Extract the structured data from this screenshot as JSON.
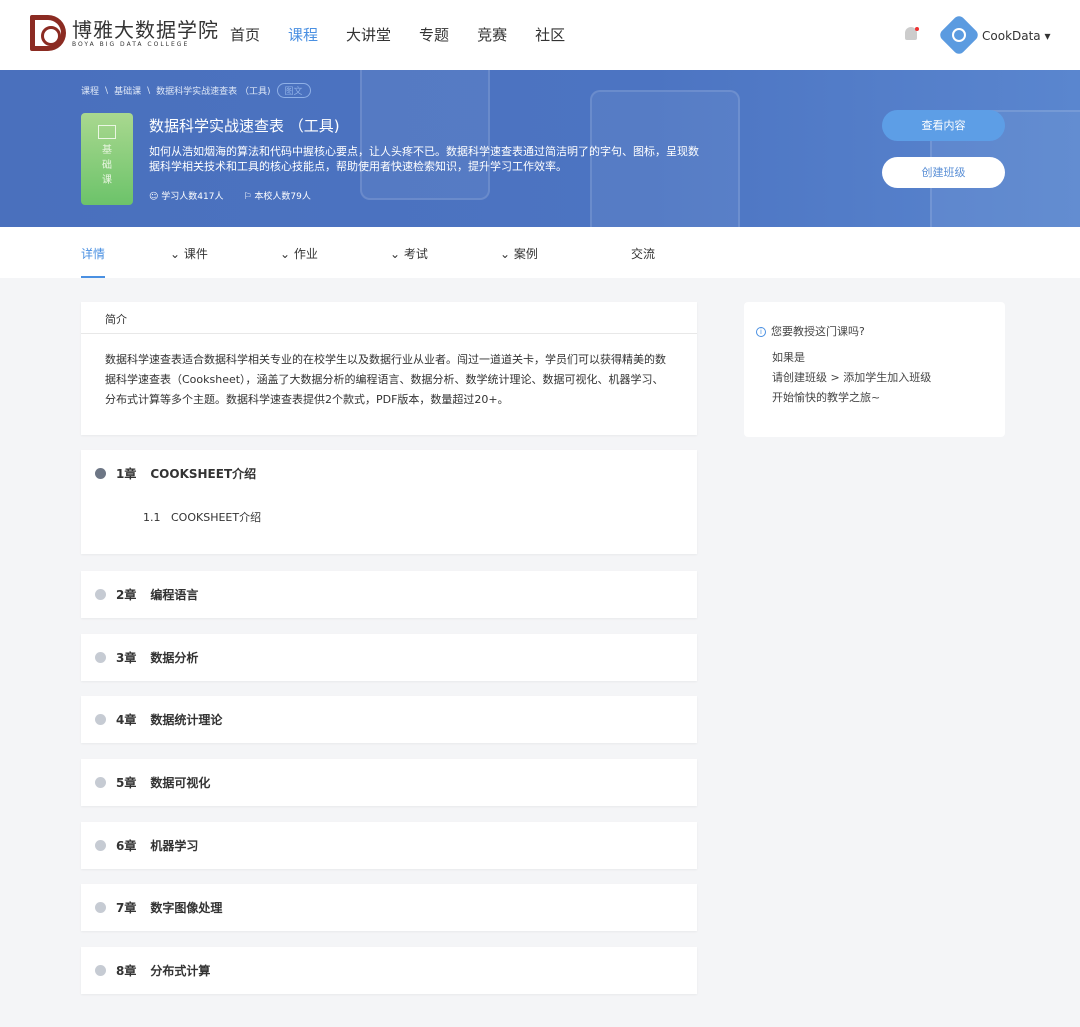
{
  "header": {
    "logo_cn": "博雅大数据学院",
    "logo_en": "BOYA BIG DATA COLLEGE",
    "nav": [
      "首页",
      "课程",
      "大讲堂",
      "专题",
      "竞赛",
      "社区"
    ],
    "active_nav": 1,
    "username": "CookData"
  },
  "banner": {
    "breadcrumb": [
      "课程",
      "基础课",
      "数据科学实战速查表 （工具)"
    ],
    "type_tag": "图文",
    "badge": "基础课",
    "title": "数据科学实战速查表 （工具)",
    "description": "如何从浩如烟海的算法和代码中握核心要点，让人头疼不已。数据科学速查表通过简洁明了的字句、图标，呈现数据科学相关技术和工具的核心技能点，帮助使用者快速检索知识，提升学习工作效率。",
    "learners": "学习人数417人",
    "school_count": "本校人数79人",
    "view_button": "查看内容",
    "create_class_button": "创建班级"
  },
  "tabs": [
    "详情",
    "课件",
    "作业",
    "考试",
    "案例",
    "交流"
  ],
  "intro": {
    "heading": "简介",
    "body": "数据科学速查表适合数据科学相关专业的在校学生以及数据行业从业者。闯过一道道关卡，学员们可以获得精美的数据科学速查表（Cooksheet），涵盖了大数据分析的编程语言、数据分析、数学统计理论、数据可视化、机器学习、分布式计算等多个主题。数据科学速查表提供2个款式，PDF版本，数量超过20+。"
  },
  "chapters": [
    {
      "num": "1章",
      "title": "COOKSHEET介绍",
      "sections": [
        {
          "num": "1.1",
          "title": "COOKSHEET介绍"
        }
      ]
    },
    {
      "num": "2章",
      "title": "编程语言"
    },
    {
      "num": "3章",
      "title": "数据分析"
    },
    {
      "num": "4章",
      "title": "数据统计理论"
    },
    {
      "num": "5章",
      "title": "数据可视化"
    },
    {
      "num": "6章",
      "title": "机器学习"
    },
    {
      "num": "7章",
      "title": "数字图像处理"
    },
    {
      "num": "8章",
      "title": "分布式计算"
    }
  ],
  "side": {
    "question": "您要教授这门课吗?",
    "lines": [
      "如果是",
      "请创建班级 > 添加学生加入班级",
      "开始愉快的教学之旅~"
    ]
  }
}
